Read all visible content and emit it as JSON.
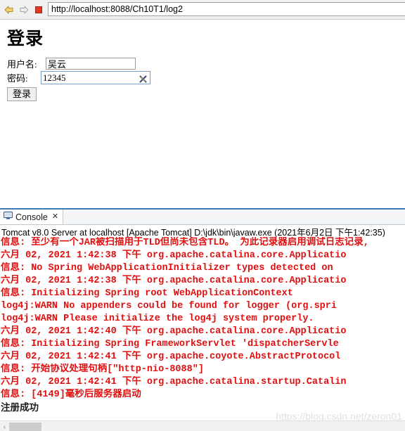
{
  "browser": {
    "url": "http://localhost:8088/Ch10T1/log2",
    "url_placeholder": "",
    "nav": {
      "back_label": "back-arrow",
      "forward_label": "forward-arrow",
      "stop_label": "stop-square",
      "refresh_label": "refresh-arrows"
    }
  },
  "page": {
    "heading": "登录",
    "username_label": "用户名:",
    "username_value": "吴云",
    "username_placeholder": "",
    "password_label": "密码:",
    "password_value": "12345",
    "password_placeholder": "",
    "clear_icon": "clear-x-icon",
    "submit_label": "登录"
  },
  "console": {
    "tab_label": "Console",
    "tab_close": "✕",
    "tab_icon": "console-monitor-icon",
    "status": "Tomcat v8.0 Server at localhost [Apache Tomcat] D:\\jdk\\bin\\javaw.exe (2021年6月2日 下午1:42:35)",
    "lines": [
      {
        "text": "信息: 至少有一个JAR被扫描用于TLD但尚未包含TLD。 为此记录器启用调试日志记录,",
        "color": "red"
      },
      {
        "text": "六月 02, 2021 1:42:38 下午 org.apache.catalina.core.Applicatio",
        "color": "red"
      },
      {
        "text": "信息: No Spring WebApplicationInitializer types detected on",
        "color": "red"
      },
      {
        "text": "六月 02, 2021 1:42:38 下午 org.apache.catalina.core.Applicatio",
        "color": "red"
      },
      {
        "text": "信息: Initializing Spring root WebApplicationContext",
        "color": "red"
      },
      {
        "text": "log4j:WARN No appenders could be found for logger (org.spri",
        "color": "red"
      },
      {
        "text": "log4j:WARN Please initialize the log4j system properly.",
        "color": "red"
      },
      {
        "text": "六月 02, 2021 1:42:40 下午 org.apache.catalina.core.Applicatio",
        "color": "red"
      },
      {
        "text": "信息: Initializing Spring FrameworkServlet 'dispatcherServle",
        "color": "red"
      },
      {
        "text": "六月 02, 2021 1:42:41 下午 org.apache.coyote.AbstractProtocol",
        "color": "red"
      },
      {
        "text": "信息: 开始协议处理句柄[\"http-nio-8088\"]",
        "color": "red"
      },
      {
        "text": "六月 02, 2021 1:42:41 下午 org.apache.catalina.startup.Catalin",
        "color": "red"
      },
      {
        "text": "信息: [4149]毫秒后服务器启动",
        "color": "red"
      },
      {
        "text": "注册成功",
        "color": "black"
      }
    ],
    "scroll_left_arrow": "‹"
  },
  "watermark": "https://blog.csdn.net/zeron01",
  "colors": {
    "log_red": "#e01010",
    "accent_blue": "#3a7ab5",
    "toolbar_bg": "#f0f0f0"
  }
}
